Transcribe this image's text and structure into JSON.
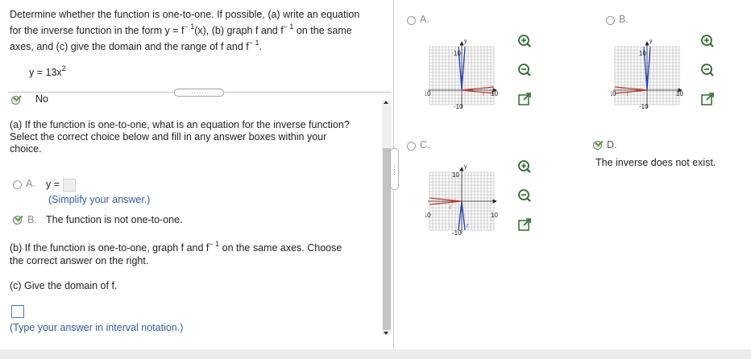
{
  "question": {
    "line1": "Determine whether the function is one-to-one. If possible, (a) write an equation",
    "line2_a": "for the inverse function in the form y = f",
    "line2_b": "(x), (b) graph f and f",
    "line2_c": " on the same",
    "line3_a": "axes, and (c) give the domain and the range of f and f",
    "line3_b": ".",
    "sup_inv": "− 1",
    "function": "y = 13x",
    "function_exp": "2"
  },
  "more_button": "......",
  "no_answer": "No",
  "part_a": {
    "prompt_1": "(a) If the function is one-to-one, what is an equation for the inverse function?",
    "prompt_2": "Select the correct choice below and fill in any answer boxes within your",
    "prompt_3": "choice.",
    "option_a_letter": "A.",
    "option_a_text": "y =",
    "option_a_hint": "(Simplify your answer.)",
    "option_b_letter": "B.",
    "option_b_text": "The function is not one-to-one."
  },
  "part_b": {
    "prompt_1a": "(b) If the function is one-to-one, graph f and f",
    "prompt_1b": " on the same axes. Choose",
    "prompt_2": "the correct answer on the right."
  },
  "part_c": {
    "prompt": "(c) Give the domain of f.",
    "hint": "(Type your answer in interval notation.)"
  },
  "graph_options": {
    "a_letter": "A.",
    "b_letter": "B.",
    "c_letter": "C.",
    "d_letter": "D.",
    "d_text": "The inverse does not exist.",
    "tick_pos": "10",
    "tick_neg": "-10",
    "axis_x": "x",
    "axis_y": "y",
    "label_f": "f",
    "label_finv": "f"
  },
  "colors": {
    "f_curve": "#c0392b",
    "finv_curve": "#1f3fc4",
    "grid": "#b0b0b0",
    "check": "#5aa02c",
    "answer_box": "#4a78c2"
  }
}
